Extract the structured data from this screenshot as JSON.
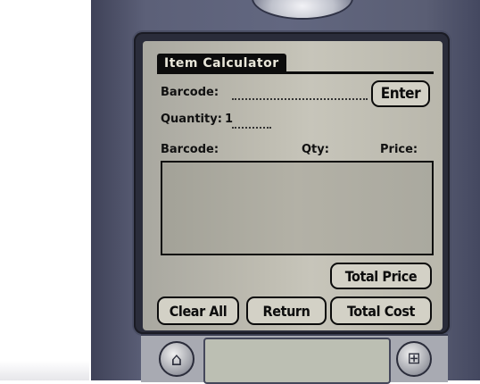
{
  "app": {
    "title": "Item Calculator"
  },
  "form": {
    "barcode_label": "Barcode:",
    "barcode_value": "",
    "enter_label": "Enter",
    "quantity_label": "Quantity:",
    "quantity_value": "1"
  },
  "table": {
    "columns": [
      "Barcode:",
      "Qty:",
      "Price:"
    ],
    "rows": []
  },
  "buttons": {
    "total_price": "Total Price",
    "clear_all": "Clear All",
    "return": "Return",
    "total_cost": "Total Cost"
  },
  "device": {
    "home_icon": "home-icon",
    "apps_icon": "grid-icon"
  }
}
